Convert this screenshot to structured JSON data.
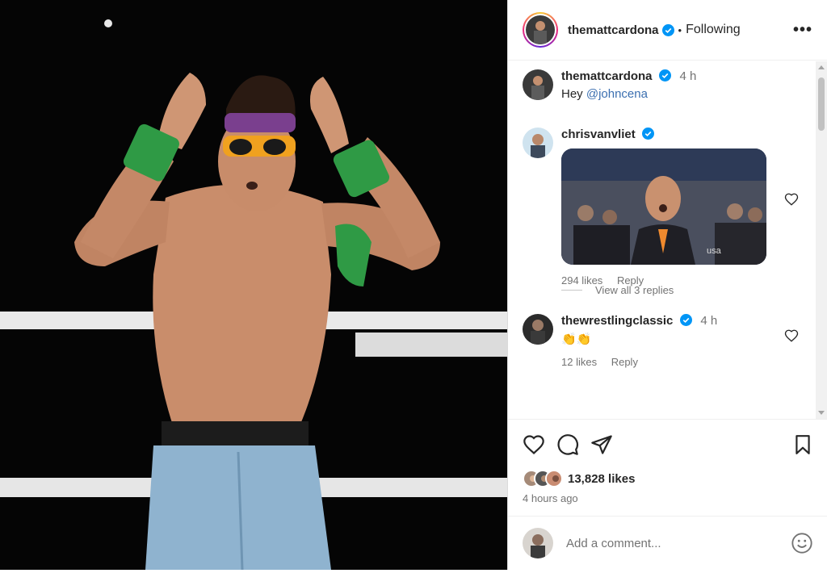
{
  "post": {
    "author": "themattcardona",
    "follow_status": "Following",
    "more_label": "•••",
    "likes": "13,828 likes",
    "time_ago": "4 hours ago"
  },
  "comments": [
    {
      "user": "themattcardona",
      "time": "4 h",
      "text_prefix": "Hey ",
      "mention": "@johncena"
    },
    {
      "user": "chrisvanvliet",
      "likes": "294 likes",
      "reply": "Reply",
      "view_replies": "View all 3 replies",
      "gif_badge": "usa"
    },
    {
      "user": "thewrestlingclassic",
      "time": "4 h",
      "text": "👏👏",
      "likes": "12 likes",
      "reply": "Reply"
    }
  ],
  "composer": {
    "placeholder": "Add a comment..."
  },
  "colors": {
    "verified": "#0095f6",
    "link": "#3b6fb0",
    "muted": "#737373"
  },
  "icons": [
    "verified-badge-icon",
    "more-options-icon",
    "heart-icon",
    "comment-icon",
    "share-icon",
    "save-icon",
    "emoji-icon"
  ]
}
